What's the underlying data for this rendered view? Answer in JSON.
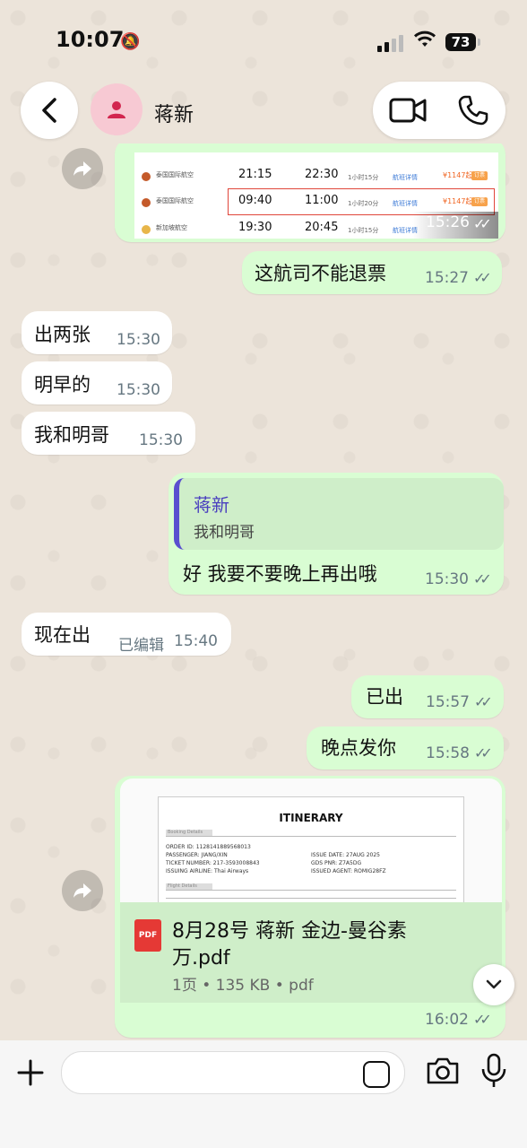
{
  "status_bar": {
    "time": "10:07",
    "battery": "73"
  },
  "header": {
    "contact_name": "蒋新"
  },
  "flight_card": {
    "rows": [
      {
        "dep": "21:15",
        "arr": "22:30",
        "price": "¥1147起",
        "selected": false
      },
      {
        "dep": "09:40",
        "arr": "11:00",
        "price": "¥1147起",
        "selected": true
      },
      {
        "dep": "19:30",
        "arr": "20:45",
        "price": "",
        "selected": false
      }
    ],
    "time": "15:26"
  },
  "messages": [
    {
      "id": "m1",
      "dir": "out",
      "text": "这航司不能退票",
      "time": "15:27"
    },
    {
      "id": "m2",
      "dir": "in",
      "text": "出两张",
      "time": "15:30"
    },
    {
      "id": "m3",
      "dir": "in",
      "text": "明早的",
      "time": "15:30"
    },
    {
      "id": "m4",
      "dir": "in",
      "text": "我和明哥",
      "time": "15:30"
    },
    {
      "id": "m5",
      "dir": "out",
      "text": "好 我要不要晚上再出哦",
      "time": "15:30",
      "reply": {
        "name": "蒋新",
        "text": "我和明哥"
      }
    },
    {
      "id": "m6",
      "dir": "in",
      "text": "现在出",
      "edited": "已编辑",
      "time": "15:40"
    },
    {
      "id": "m7",
      "dir": "out",
      "text": "已出",
      "time": "15:57"
    },
    {
      "id": "m8",
      "dir": "out",
      "text": "晚点发你",
      "time": "15:58"
    }
  ],
  "document": {
    "preview": {
      "title": "ITINERARY",
      "section1": "Booking Details",
      "order_id": "ORDER ID: 1128141889568013",
      "passenger": "PASSENGER: JIANG/XIN",
      "ticket": "TICKET NUMBER: 217-3593008843",
      "airline": "ISSUING AIRLINE: Thai Airways",
      "issue_date": "ISSUE DATE: 27AUG 2025",
      "gds": "GDS PNR: Z7A5DG",
      "agent": "ISSUED AGENT: ROMIG28FZ",
      "section2": "Flight Details"
    },
    "icon_label": "PDF",
    "name_line1": "8月28号 蒋新 金边-曼谷素",
    "name_line2": "万.pdf",
    "meta": "1页 • 135 KB • pdf",
    "time": "16:02"
  },
  "ticks": "✓✓"
}
